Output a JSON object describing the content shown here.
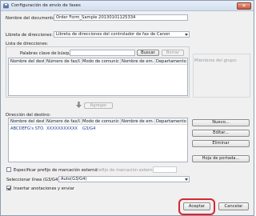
{
  "window": {
    "title": "Configuración de envío de faxes",
    "close_label": "✕",
    "close_icon": "close-icon",
    "app_icon": "fax-app-icon"
  },
  "document": {
    "label": "Nombre del documento:",
    "value": "Order Form_Sample 20130101125334"
  },
  "addressbook": {
    "label": "Libreta de direcciones:",
    "selected": "Libreta de direcciones del controlador de fax de Canon"
  },
  "address_list": {
    "label": "Lista de direcciones:",
    "search_label": "Palabras clave de búsqueda:",
    "search_value": "",
    "search_button": "Buscar",
    "clear_button": "Borrar",
    "columns": [
      "Nombre del destino",
      "Número de fax/URI",
      "Modo de comunic...",
      "Nombre de em...",
      "Departamento"
    ],
    "rows": []
  },
  "group_members": {
    "label": "Miembros del grupo:"
  },
  "add_button": {
    "label": "Agregar",
    "icon": "arrow-down-icon"
  },
  "destinations": {
    "label": "Dirección del destino:",
    "columns": [
      "Nombre del destino",
      "Número de fax/URI",
      "Modo de comunic...",
      "Nombre de em...",
      "Departamento"
    ],
    "rows": [
      {
        "name": "ABCDEFG's STO...",
        "fax": "XXXXXXXXXXX",
        "mode": "G3/G4",
        "company": "",
        "department": ""
      }
    ]
  },
  "side_buttons": {
    "new": "Nuevo...",
    "edit": "Editar...",
    "delete": "Eliminar",
    "cover": "Hoja de portada..."
  },
  "outside_dial": {
    "label": "Especificar prefijo de marcación externa",
    "checked": false,
    "prefix_label": "Prefijo de marcación externa:",
    "prefix_value": ""
  },
  "line": {
    "label": "Seleccionar línea (G3/G4):",
    "selected": "Auto(G3/G4)"
  },
  "annotations": {
    "label": "Insertar anotaciones y enviar",
    "checked": true
  },
  "footer": {
    "accept": "Aceptar",
    "cancel": "Cancelar"
  },
  "colors": {
    "highlight": "#d8262f",
    "window_bg": "#f0f0f0",
    "title_gradient_top": "#e6eef8"
  }
}
